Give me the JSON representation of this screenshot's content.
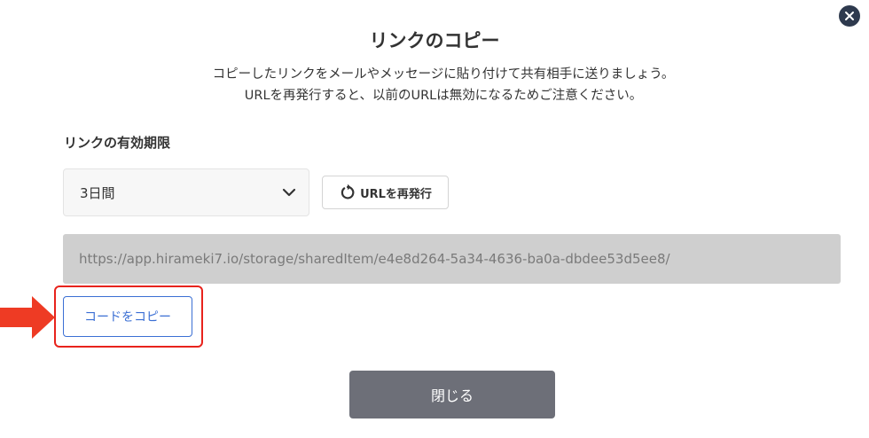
{
  "modal": {
    "title": "リンクのコピー",
    "description_line1": "コピーしたリンクをメールやメッセージに貼り付けて共有相手に送りましょう。",
    "description_line2": "URLを再発行すると、以前のURLは無効になるためご注意ください。"
  },
  "expiry": {
    "label": "リンクの有効期限",
    "selected": "3日間"
  },
  "reissue": {
    "label": "URLを再発行"
  },
  "share_url": {
    "value": "https://app.hirameki7.io/storage/sharedItem/e4e8d264-5a34-4636-ba0a-dbdee53d5ee8/"
  },
  "copy": {
    "label": "コードをコピー"
  },
  "footer": {
    "close_label": "閉じる"
  },
  "icons": {
    "close": "close-icon",
    "chevron": "chevron-down-icon",
    "reissue": "refresh-icon",
    "annotation": "arrow-right-icon"
  },
  "colors": {
    "accent_blue": "#3b6fd4",
    "highlight_red": "#e8231c",
    "arrow_red": "#ee3b24",
    "close_button_bg": "#6d6f78",
    "url_field_bg": "#cfcfcf"
  }
}
